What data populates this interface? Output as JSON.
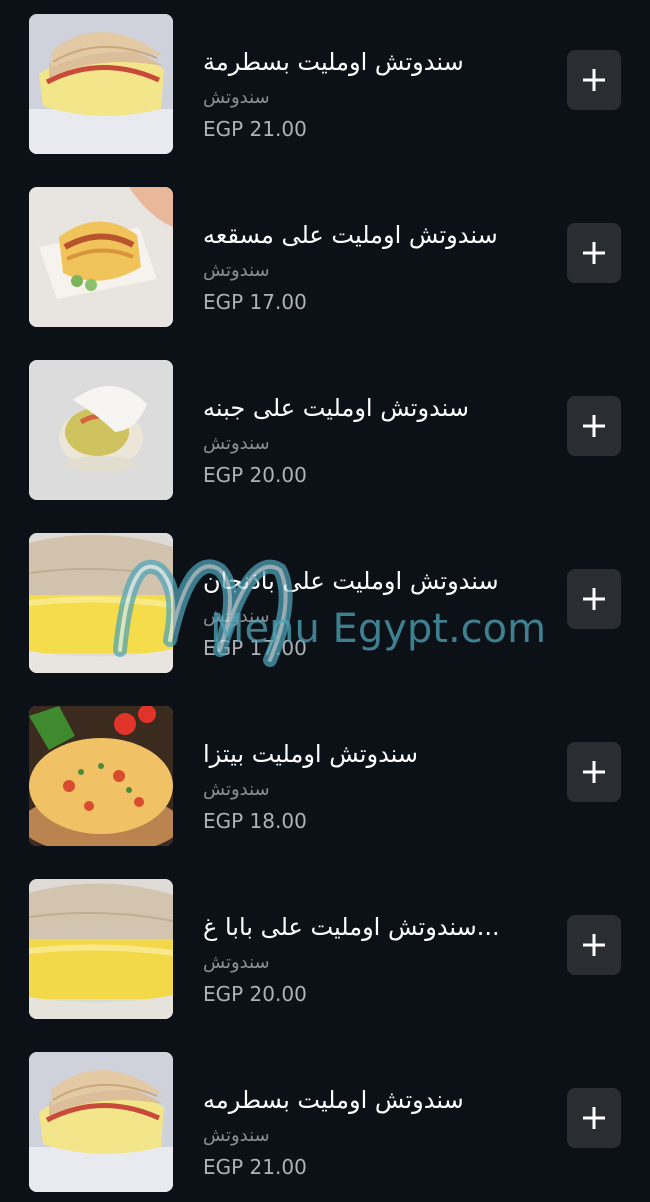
{
  "menu": {
    "items": [
      {
        "name": "سندوتش اومليت بسطرمة",
        "category": "سندوتش",
        "price": "EGP 21.00",
        "image": "pastrami-omelette-pita"
      },
      {
        "name": "سندوتش اومليت على مسقعه",
        "category": "سندوتش",
        "price": "EGP 17.00",
        "image": "moussaka-omelette-pita"
      },
      {
        "name": "سندوتش اومليت على جبنه",
        "category": "سندوتش",
        "price": "EGP 20.00",
        "image": "cheese-omelette-pita"
      },
      {
        "name": "سندوتش اومليت على باذنجان",
        "category": "سندوتش",
        "price": "EGP 17.00",
        "image": "eggplant-omelette-bread"
      },
      {
        "name": "سندوتش اومليت بيتزا",
        "category": "سندوتش",
        "price": "EGP 18.00",
        "image": "pizza-omelette"
      },
      {
        "name": "سندوتش اومليت على بابا غ...",
        "category": "سندوتش",
        "price": "EGP 20.00",
        "image": "baba-ghanoush-omelette-bread"
      },
      {
        "name": "سندوتش اومليت بسطرمه",
        "category": "سندوتش",
        "price": "EGP 21.00",
        "image": "pastrami-omelette-pita"
      }
    ],
    "add_icon": "plus-icon"
  },
  "watermark": {
    "text": "Menu Egypt.com",
    "color": "#4fa5b8"
  },
  "colors": {
    "background": "#0c1117",
    "add_button": "#2a2d32",
    "title": "#ffffff",
    "category": "#8b8f95",
    "price": "#aeb2b8"
  }
}
